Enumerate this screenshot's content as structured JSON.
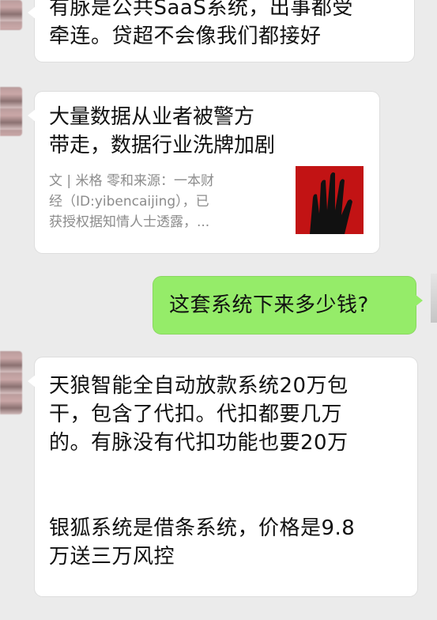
{
  "messages": [
    {
      "from": "other",
      "type": "text",
      "text": "有脉是公共SaaS系统，出事都受\n牵连。贷超不会像我们都接好"
    },
    {
      "from": "other",
      "type": "link_card",
      "title": "大量数据从业者被警方\n带走，数据行业洗牌加剧",
      "description": "文 | 米格 零和来源：一本财\n经（ID:yibencaijing），已\n获授权据知情人士透露，...",
      "thumb_icon": "hand-icon",
      "colors": {
        "thumb_bg": "#c21314",
        "hand": "#111111"
      }
    },
    {
      "from": "me",
      "type": "text",
      "text": "这套系统下来多少钱?"
    },
    {
      "from": "other",
      "type": "text",
      "text": "天狼智能全自动放款系统20万包\n干，包含了代扣。代扣都要几万\n的。有脉没有代扣功能也要20万\n\n\n银狐系统是借条系统，价格是9.8\n万送三万风控"
    }
  ],
  "colors": {
    "background": "#ebebeb",
    "bubble_other": "#ffffff",
    "bubble_me": "#95ec69"
  }
}
